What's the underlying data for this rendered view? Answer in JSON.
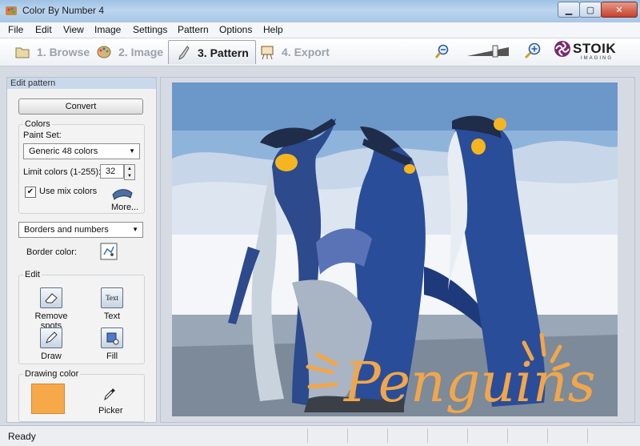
{
  "window": {
    "title": "Color By Number 4"
  },
  "menu": [
    "File",
    "Edit",
    "View",
    "Image",
    "Settings",
    "Pattern",
    "Options",
    "Help"
  ],
  "steps": [
    {
      "label": "1. Browse",
      "active": false
    },
    {
      "label": "2. Image",
      "active": false
    },
    {
      "label": "3. Pattern",
      "active": true
    },
    {
      "label": "4. Export",
      "active": false
    }
  ],
  "brand": {
    "name": "STOIK",
    "sub": "IMAGING",
    "color": "#7a2a6e"
  },
  "panel": {
    "title": "Edit pattern",
    "convert_label": "Convert",
    "colors_group": "Colors",
    "paint_set_label": "Paint Set:",
    "paint_set_value": "Generic 48 colors",
    "limit_label": "Limit colors (1-255):",
    "limit_value": "32",
    "mix_label": "Use mix colors",
    "mix_checked": true,
    "more_label": "More...",
    "mode_value": "Borders and numbers",
    "border_color_label": "Border color:",
    "edit_group": "Edit",
    "tools": [
      "Remove spots",
      "Text",
      "Draw",
      "Fill"
    ],
    "text_icon_label": "Text",
    "drawing_color_group": "Drawing color",
    "drawing_color": "#f7a94a",
    "picker_label": "Picker"
  },
  "picture": {
    "caption": "Penguins"
  },
  "status": {
    "text": "Ready"
  }
}
